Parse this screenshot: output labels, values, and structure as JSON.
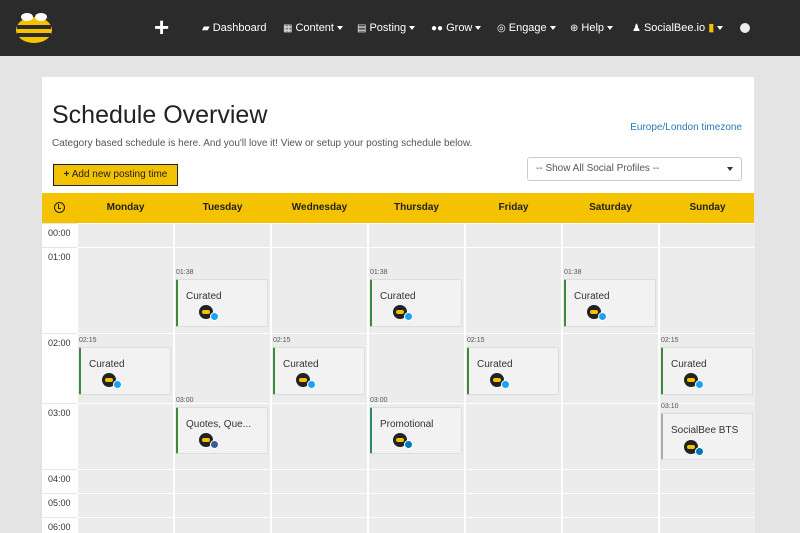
{
  "nav": {
    "items": [
      {
        "label": "Dashboard",
        "icon": "dashboard-icon"
      },
      {
        "label": "Content",
        "icon": "content-icon"
      },
      {
        "label": "Posting",
        "icon": "calendar-icon"
      },
      {
        "label": "Grow",
        "icon": "users-icon"
      },
      {
        "label": "Engage",
        "icon": "engage-icon"
      },
      {
        "label": "Help",
        "icon": "help-icon"
      },
      {
        "label": "SocialBee.io",
        "icon": "user-icon"
      }
    ]
  },
  "page": {
    "title": "Schedule Overview",
    "subtitle": "Category based schedule is here. And you'll love it! View or setup your posting schedule below.",
    "timezone": "Europe/London timezone",
    "add_button": "Add new posting time",
    "profile_select": "-- Show All Social Profiles --"
  },
  "schedule": {
    "days": [
      "Monday",
      "Tuesday",
      "Wednesday",
      "Thursday",
      "Friday",
      "Saturday",
      "Sunday"
    ],
    "hours": [
      "00:00",
      "01:00",
      "02:00",
      "03:00",
      "04:00",
      "05:00",
      "06:00"
    ],
    "posts": [
      {
        "day": "Tuesday",
        "time": "01:38",
        "label": "Curated",
        "network": "twitter"
      },
      {
        "day": "Thursday",
        "time": "01:38",
        "label": "Curated",
        "network": "twitter"
      },
      {
        "day": "Saturday",
        "time": "01:38",
        "label": "Curated",
        "network": "twitter"
      },
      {
        "day": "Monday",
        "time": "02:15",
        "label": "Curated",
        "network": "twitter"
      },
      {
        "day": "Wednesday",
        "time": "02:15",
        "label": "Curated",
        "network": "twitter"
      },
      {
        "day": "Friday",
        "time": "02:15",
        "label": "Curated",
        "network": "twitter"
      },
      {
        "day": "Sunday",
        "time": "02:15",
        "label": "Curated",
        "network": "twitter"
      },
      {
        "day": "Tuesday",
        "time": "03:00",
        "label": "Quotes, Que...",
        "network": "facebook"
      },
      {
        "day": "Thursday",
        "time": "03:00",
        "label": "Promotional",
        "network": "linkedin"
      },
      {
        "day": "Sunday",
        "time": "03:10",
        "label": "SocialBee BTS",
        "network": "linkedin"
      }
    ]
  },
  "colors": {
    "accent": "#f5c200",
    "topbar": "#2b2b2b",
    "link": "#2a7ab8",
    "twitter": "#1da1f2",
    "facebook": "#3b5998",
    "linkedin": "#0077b5"
  }
}
